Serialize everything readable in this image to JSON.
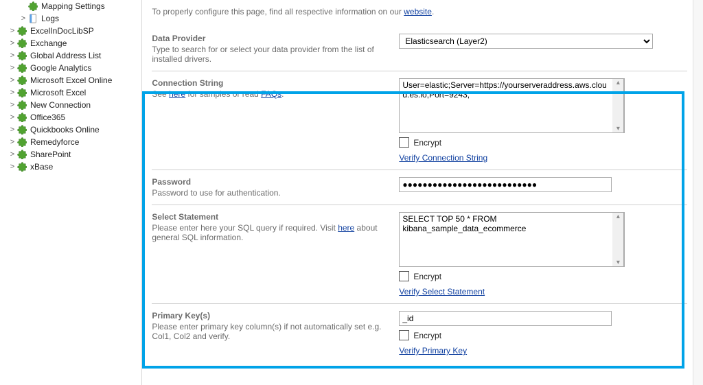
{
  "tree": {
    "items": [
      {
        "label": "Mapping Settings",
        "toggle": "",
        "indent": 24,
        "icon": "puzzle"
      },
      {
        "label": "Logs",
        "toggle": ">",
        "indent": 24,
        "icon": "notebook"
      },
      {
        "label": "ExcelInDocLibSP",
        "toggle": ">",
        "indent": 8,
        "icon": "puzzle"
      },
      {
        "label": "Exchange",
        "toggle": ">",
        "indent": 8,
        "icon": "puzzle"
      },
      {
        "label": "Global Address List",
        "toggle": ">",
        "indent": 8,
        "icon": "puzzle"
      },
      {
        "label": "Google Analytics",
        "toggle": ">",
        "indent": 8,
        "icon": "puzzle"
      },
      {
        "label": "Microsoft Excel Online",
        "toggle": ">",
        "indent": 8,
        "icon": "puzzle"
      },
      {
        "label": "Microsoft Excel",
        "toggle": ">",
        "indent": 8,
        "icon": "puzzle"
      },
      {
        "label": "New Connection",
        "toggle": ">",
        "indent": 8,
        "icon": "puzzle"
      },
      {
        "label": "Office365",
        "toggle": ">",
        "indent": 8,
        "icon": "puzzle"
      },
      {
        "label": "Quickbooks Online",
        "toggle": ">",
        "indent": 8,
        "icon": "puzzle"
      },
      {
        "label": "Remedyforce",
        "toggle": ">",
        "indent": 8,
        "icon": "puzzle"
      },
      {
        "label": "SharePoint",
        "toggle": ">",
        "indent": 8,
        "icon": "puzzle"
      },
      {
        "label": "xBase",
        "toggle": ">",
        "indent": 8,
        "icon": "puzzle"
      }
    ]
  },
  "intro": {
    "prefix": "To properly configure this page, find all respective information on our ",
    "link": "website",
    "suffix": "."
  },
  "dataProvider": {
    "title": "Data Provider",
    "desc": "Type to search for or select your data provider from the list of installed drivers.",
    "value": "Elasticsearch (Layer2)"
  },
  "connString": {
    "title": "Connection String",
    "desc_prefix": "See ",
    "desc_link1": "here",
    "desc_mid": " for samples or read ",
    "desc_link2": "FAQs",
    "desc_suffix": ".",
    "value": "User=elastic;Server=https://yourserveraddress.aws.cloud.es.io;Port=9243;",
    "encrypt": "Encrypt",
    "verify": "Verify Connection String"
  },
  "password": {
    "title": "Password",
    "desc": "Password to use for authentication.",
    "value": "●●●●●●●●●●●●●●●●●●●●●●●●●●●"
  },
  "selectStmt": {
    "title": "Select Statement",
    "desc_prefix": "Please enter here your SQL query if required. Visit ",
    "desc_link": "here",
    "desc_suffix": " about general SQL information.",
    "value": "SELECT TOP 50 * FROM kibana_sample_data_ecommerce",
    "encrypt": "Encrypt",
    "verify": "Verify Select Statement"
  },
  "primaryKey": {
    "title": "Primary Key(s)",
    "desc": "Please enter primary key column(s) if not automatically set e.g. Col1, Col2 and verify.",
    "value": "_id",
    "encrypt": "Encrypt",
    "verify": "Verify Primary Key"
  }
}
